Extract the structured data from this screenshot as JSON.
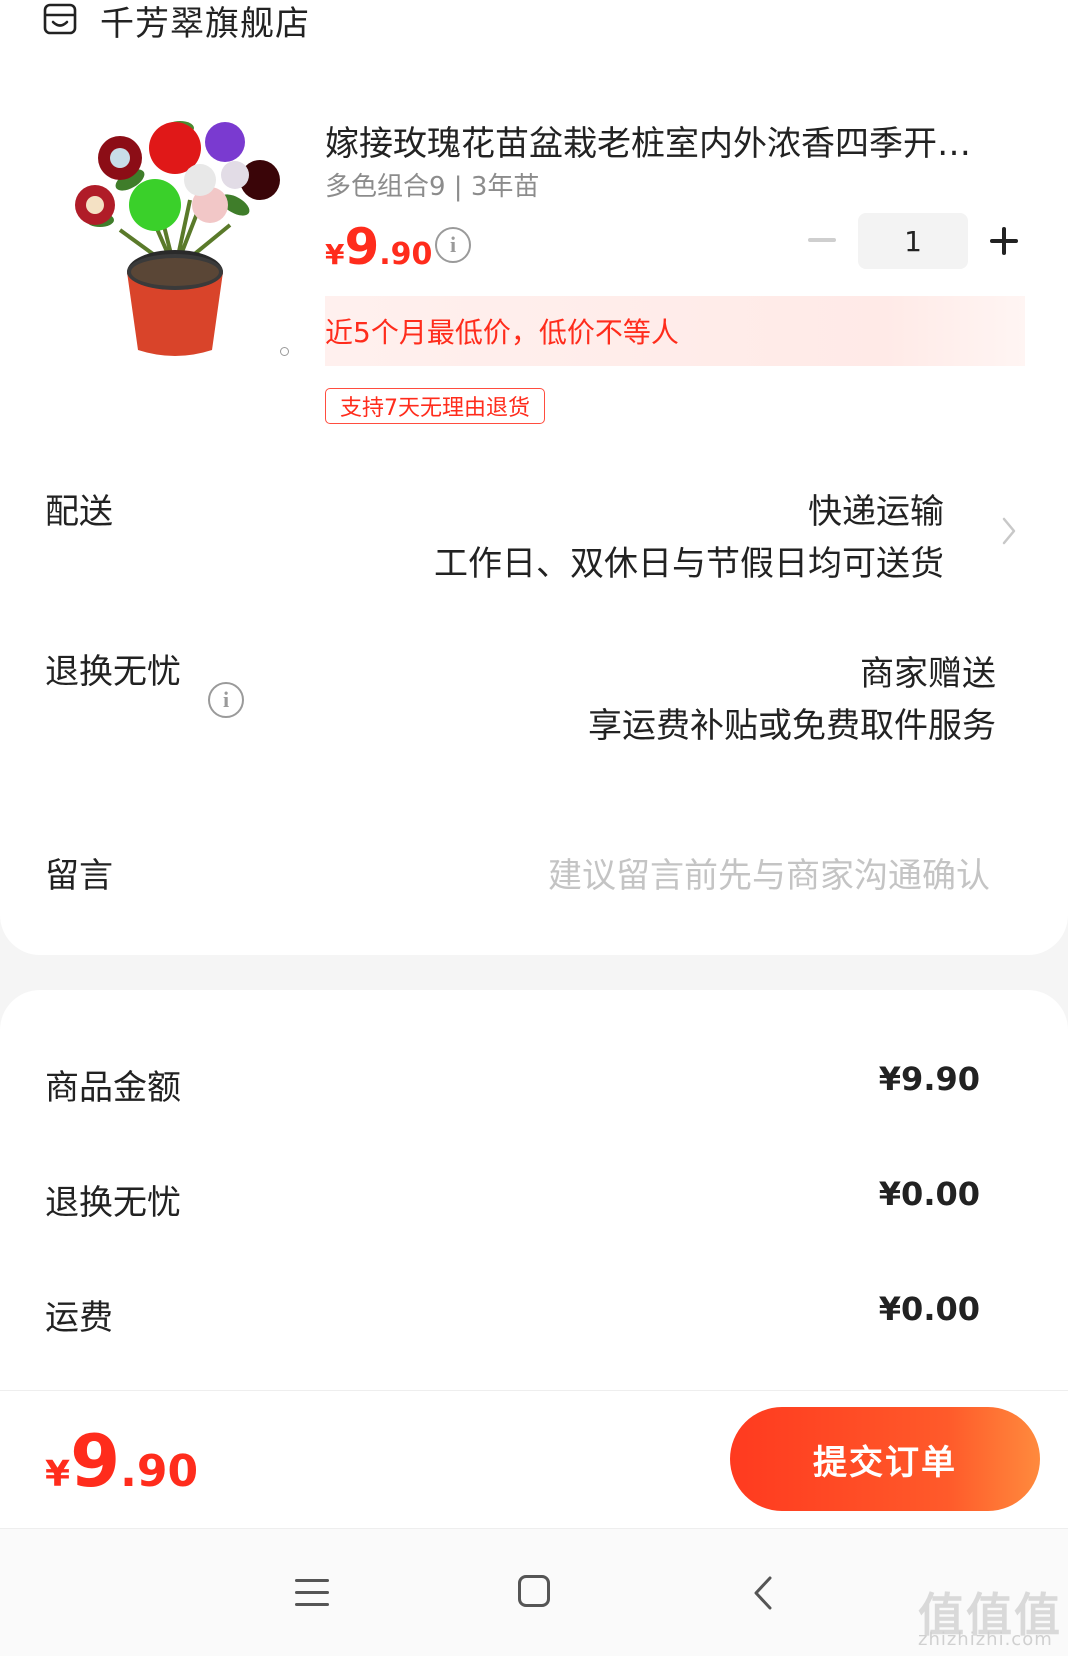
{
  "shop": {
    "name": "千芳翠旗舰店",
    "icon": "store-icon"
  },
  "product": {
    "title": "嫁接玫瑰花苗盆栽老桩室内外浓香四季开…",
    "spec": "多色组合9 | 3年苗",
    "price_currency": "¥",
    "price_int": "9",
    "price_dec": ".90",
    "quantity": "1",
    "low_price_note": "近5个月最低价，低价不等人",
    "return_tag": "支持7天无理由退货"
  },
  "delivery": {
    "label": "配送",
    "method": "快递运输",
    "note": "工作日、双休日与节假日均可送货"
  },
  "return_service": {
    "label": "退换无忧",
    "value": "商家赠送",
    "note": "享运费补贴或免费取件服务"
  },
  "message": {
    "label": "留言",
    "placeholder": "建议留言前先与商家沟通确认"
  },
  "summary": [
    {
      "label": "商品金额",
      "value": "¥9.90"
    },
    {
      "label": "退换无忧",
      "value": "¥0.00"
    },
    {
      "label": "运费",
      "value": "¥0.00"
    }
  ],
  "footer": {
    "total_currency": "¥",
    "total_int": "9",
    "total_dec": ".90",
    "submit_label": "提交订单"
  },
  "watermark": {
    "text": "值值值",
    "sub": "zhizhizhi.com"
  },
  "colors": {
    "accent": "#ff2c1c",
    "button_start": "#ff3a1f",
    "button_end": "#ff8a3d"
  }
}
